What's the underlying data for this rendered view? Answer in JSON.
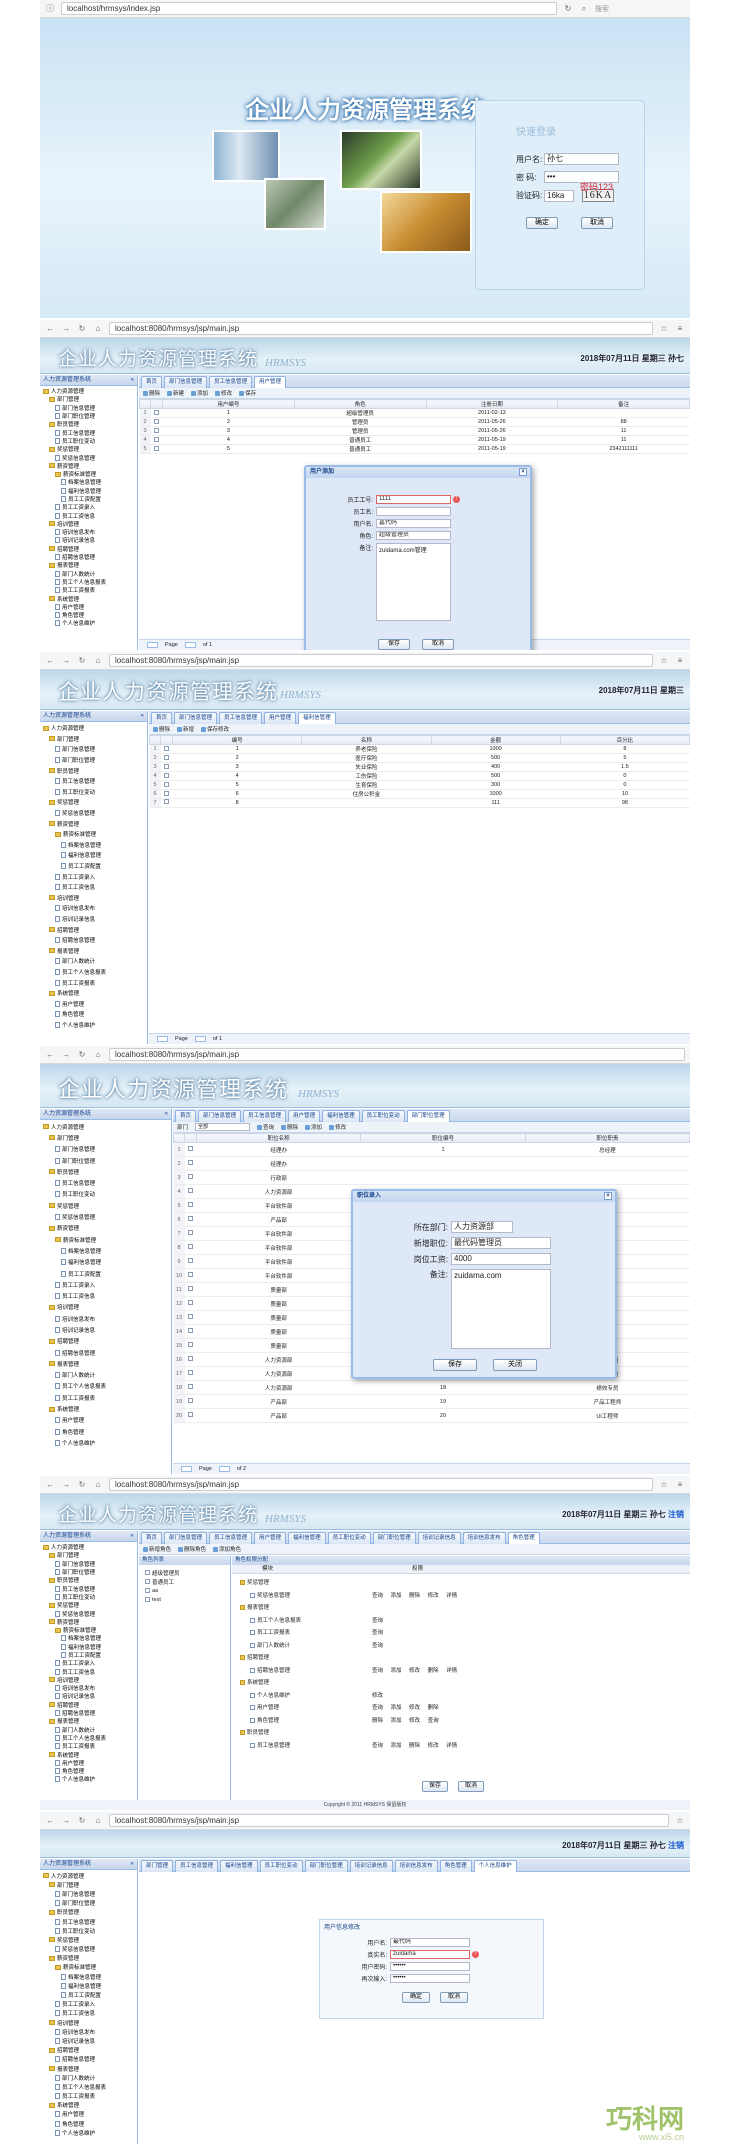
{
  "login": {
    "url": "localhost/hrmsys/index.jsp",
    "search_placeholder": "搜索",
    "system_title": "企业人力资源管理系统",
    "box_title": "快速登录",
    "username_label": "用户名:",
    "username_value": "孙七",
    "password_label": "密  码:",
    "password_value": "•••",
    "captcha_label": "验证码:",
    "captcha_value": "16ka",
    "captcha_image": "16KA",
    "annotation": "密码123",
    "ok_label": "确定",
    "cancel_label": "取消"
  },
  "common": {
    "url": "localhost:8080/hrmsys/jsp/main.jsp",
    "system_title": "企业人力资源管理系统",
    "subtitle": "HRMSYS",
    "date_text": "2018年07月11日 星期三",
    "user_text": "孙七",
    "logout_text": "注销",
    "nav_title": "人力资源管理系统",
    "page_label": "Page",
    "of1": "of 1",
    "of2": "of 2"
  },
  "tree": [
    "人力资源管理",
    "部门管理",
    "部门信息管理",
    "部门职位管理",
    "职员管理",
    "员工信息管理",
    "员工职位变动",
    "奖惩管理",
    "奖惩信息管理",
    "薪资管理",
    "薪资标准管理",
    "档案信息管理",
    "福利信息管理",
    "员工工资配置",
    "员工工资录入",
    "员工工资信息",
    "培训管理",
    "培训信息发布",
    "培训记录信息",
    "招聘管理",
    "招聘信息管理",
    "报表管理",
    "部门人数统计",
    "员工个人信息报表",
    "员工工资报表",
    "系统管理",
    "用户管理",
    "角色管理",
    "个人信息维护"
  ],
  "p2": {
    "tabs": [
      "首页",
      "部门信息管理",
      "员工信息管理",
      "用户管理"
    ],
    "toolbar": [
      "删除",
      "新建",
      "添加",
      "修改",
      "保存"
    ],
    "cols": [
      "用户编号",
      "角色",
      "注册日期",
      "备注"
    ],
    "rows": [
      {
        "no": "1",
        "role": "超级管理员",
        "date": "2011-02-13",
        "note": ""
      },
      {
        "no": "2",
        "role": "管理员",
        "date": "2011-05-26",
        "note": "88"
      },
      {
        "no": "3",
        "role": "管理员",
        "date": "2011-05-26",
        "note": "11"
      },
      {
        "no": "4",
        "role": "普通员工",
        "date": "2011-05-19",
        "note": "11"
      },
      {
        "no": "5",
        "role": "普通员工",
        "date": "2011-05-19",
        "note": "2342111111"
      }
    ],
    "dialog_title": "用户添加",
    "emp_no_label": "员工工号:",
    "emp_no_value": "1111",
    "emp_name_label": "员工名:",
    "user_label": "用户名:",
    "user_value": "嘉代码",
    "role_label": "角色:",
    "role_value": "超级管理员",
    "note_label": "备注:",
    "note_value": "zuidama.com管理",
    "save": "保存",
    "cancel": "取消"
  },
  "p3": {
    "tabs": [
      "首页",
      "部门信息管理",
      "员工信息管理",
      "用户管理",
      "福利信管理"
    ],
    "toolbar": [
      "删除",
      "新增",
      "保存修改"
    ],
    "cols": [
      "编号",
      "名称",
      "金额",
      "百分比"
    ],
    "rows": [
      {
        "no": "1",
        "name": "养老保险",
        "amt": "1000",
        "pct": "8"
      },
      {
        "no": "2",
        "name": "医疗保险",
        "amt": "500",
        "pct": "5"
      },
      {
        "no": "3",
        "name": "失业保险",
        "amt": "400",
        "pct": "1.5"
      },
      {
        "no": "4",
        "name": "工伤保险",
        "amt": "500",
        "pct": "0"
      },
      {
        "no": "5",
        "name": "生育保险",
        "amt": "300",
        "pct": "0"
      },
      {
        "no": "6",
        "name": "住房公积金",
        "amt": "1000",
        "pct": "10"
      },
      {
        "no": "8",
        "name": "",
        "amt": "111",
        "pct": "98"
      }
    ]
  },
  "p4": {
    "tabs": [
      "首页",
      "部门信息管理",
      "员工信息管理",
      "用户管理",
      "福利信管理",
      "员工职位变动",
      "部门职位管理"
    ],
    "filter_label": "部门",
    "filter_value": "全部",
    "toolbar": [
      "查询",
      "删除",
      "添加",
      "修改"
    ],
    "cols": [
      "职位名称",
      "职位编号",
      "职位职责"
    ],
    "rows": [
      {
        "name": "经理办",
        "no": "1",
        "duty": "总经理"
      },
      {
        "name": "经理办",
        "no": "",
        "duty": ""
      },
      {
        "name": "行政部",
        "no": "",
        "duty": ""
      },
      {
        "name": "人力资源部",
        "no": "",
        "duty": ""
      },
      {
        "name": "平台软件部",
        "no": "",
        "duty": ""
      },
      {
        "name": "产品部",
        "no": "",
        "duty": ""
      },
      {
        "name": "平台软件部",
        "no": "",
        "duty": ""
      },
      {
        "name": "平台软件部",
        "no": "",
        "duty": ""
      },
      {
        "name": "平台软件部",
        "no": "",
        "duty": ""
      },
      {
        "name": "平台软件部",
        "no": "",
        "duty": ""
      },
      {
        "name": "质量部",
        "no": "",
        "duty": ""
      },
      {
        "name": "质量部",
        "no": "",
        "duty": ""
      },
      {
        "name": "质量部",
        "no": "",
        "duty": ""
      },
      {
        "name": "质量部",
        "no": "",
        "duty": ""
      },
      {
        "name": "质量部",
        "no": "",
        "duty": ""
      },
      {
        "name": "人力资源部",
        "no": "16",
        "duty": "培训专员"
      },
      {
        "name": "人力资源部",
        "no": "17",
        "duty": "招聘专员"
      },
      {
        "name": "人力资源部",
        "no": "18",
        "duty": "绩效专员"
      },
      {
        "name": "产品部",
        "no": "19",
        "duty": "产品工程师"
      },
      {
        "name": "产品部",
        "no": "20",
        "duty": "UI工程师"
      }
    ],
    "dialog_title": "职位录入",
    "dept_label": "所在部门:",
    "dept_value": "人力资源部",
    "pos_label": "新增职位:",
    "pos_value": "最代码管理员",
    "duty_label": "岗位工资:",
    "duty_value": "4000",
    "note_label": "备注:",
    "note_value": "zuidama.com",
    "save": "保存",
    "close": "关闭"
  },
  "p5": {
    "tabs": [
      "首页",
      "部门信息管理",
      "员工信息管理",
      "用户管理",
      "福利信管理",
      "员工职位变动",
      "部门职位管理",
      "培训记录信息",
      "培训信息发布",
      "角色管理"
    ],
    "toolbar": [
      "新增角色",
      "删除角色",
      "添加角色"
    ],
    "role_list_title": "角色列表",
    "roles": [
      "超级管理员",
      "普通员工",
      "aa",
      "test"
    ],
    "perm_title": "角色权限分配",
    "perm_cols": [
      "模块",
      "权限"
    ],
    "modules": [
      {
        "name": "奖惩管理",
        "indent": 0
      },
      {
        "name": "奖惩信息管理",
        "indent": 1,
        "perms": "查询 添加 删除 修改 详情"
      },
      {
        "name": "报表管理",
        "indent": 0
      },
      {
        "name": "员工个人信息报表",
        "indent": 1,
        "perms": "查询"
      },
      {
        "name": "员工工资报表",
        "indent": 1,
        "perms": "查询"
      },
      {
        "name": "部门人数统计",
        "indent": 1,
        "perms": "查询"
      },
      {
        "name": "招聘管理",
        "indent": 0
      },
      {
        "name": "招聘信息管理",
        "indent": 1,
        "perms": "查询 添加 修改 删除 详情"
      },
      {
        "name": "系统管理",
        "indent": 0
      },
      {
        "name": "个人信息维护",
        "indent": 1,
        "perms": "修改"
      },
      {
        "name": "用户管理",
        "indent": 1,
        "perms": "查询 添加 修改 删除"
      },
      {
        "name": "角色管理",
        "indent": 1,
        "perms": "删除 添加 修改 查询"
      },
      {
        "name": "职员管理",
        "indent": 0
      },
      {
        "name": "员工信息管理",
        "indent": 1,
        "perms": "查询 添加 删除 修改 详情"
      }
    ],
    "save": "保存",
    "cancel": "取消",
    "copyright": "Copyright © 2011 HRMSYS 保留版权"
  },
  "p6": {
    "tabs": [
      "部门管理",
      "员工信息管理",
      "福利信管理",
      "员工职位变动",
      "部门职位管理",
      "培训记录信息",
      "培训信息发布",
      "角色管理",
      "个人信息维护"
    ],
    "form_title": "用户信息修改",
    "user_label": "用户名:",
    "user_value": "最代码",
    "real_label": "真实名:",
    "real_value": "zuidama",
    "pwd_label": "用户密码:",
    "pwd_value": "••••••",
    "pwd2_label": "再次输入:",
    "pwd2_value": "••••••",
    "ok": "确定",
    "cancel": "取消"
  },
  "watermark": {
    "brand": "巧科网",
    "url": "www.xl5.cn"
  }
}
